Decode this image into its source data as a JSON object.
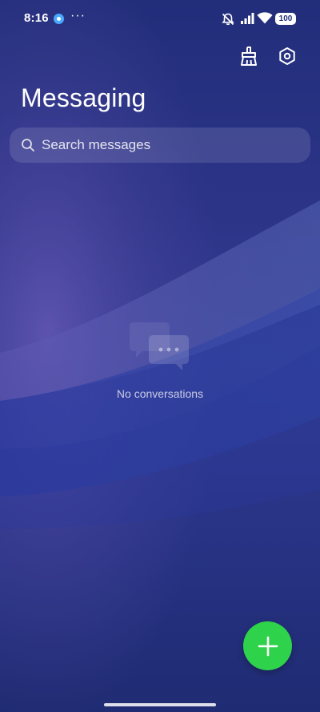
{
  "status_bar": {
    "time": "8:16",
    "more": "···",
    "battery": "100"
  },
  "app": {
    "title": "Messaging"
  },
  "search": {
    "placeholder": "Search messages"
  },
  "empty_state": {
    "text": "No conversations"
  },
  "icons": {
    "brush": "brush-icon",
    "settings": "settings-icon",
    "search": "search-icon",
    "add": "plus-icon",
    "chat": "chat-bubbles-icon"
  },
  "colors": {
    "background": "#22307a",
    "accent": "#2fd24b",
    "text": "#ffffff"
  }
}
